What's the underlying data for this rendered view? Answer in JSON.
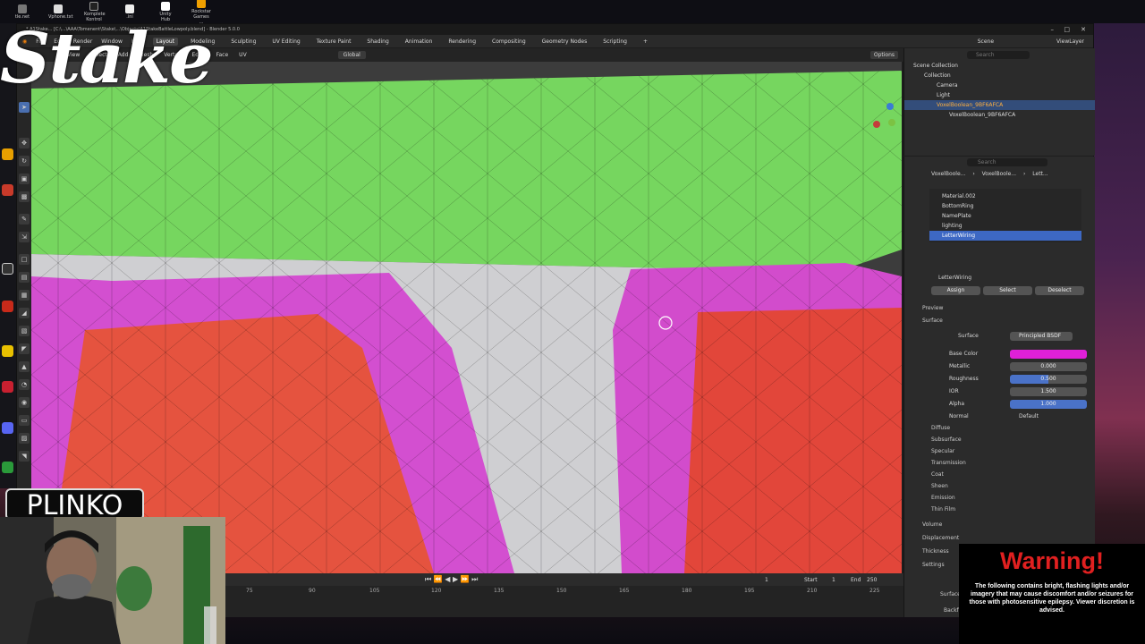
{
  "window_title": "* A1Stake... [C:\\...\\AAA\\Tomenent\\Stake\\...\\Objects\\A1StakeBattleLowpoly.blend] - Blender 5.0.0",
  "taskbar": [
    {
      "label": "tle.net"
    },
    {
      "label": "Vphone.txt"
    },
    {
      "label": "Komplete Kontrol"
    },
    {
      "label": ".ini"
    },
    {
      "label": "Unity Hub"
    },
    {
      "label": "Rockstar Games ..."
    }
  ],
  "menu": [
    "File",
    "Edit",
    "Render",
    "Window",
    "Help"
  ],
  "workspaces": [
    "Layout",
    "Modeling",
    "Sculpting",
    "UV Editing",
    "Texture Paint",
    "Shading",
    "Animation",
    "Rendering",
    "Compositing",
    "Geometry Nodes",
    "Scripting",
    "+"
  ],
  "active_workspace": "Layout",
  "viewport_header": {
    "menus": [
      "View",
      "Select",
      "Add",
      "Mesh",
      "Vertex",
      "Edge",
      "Face",
      "UV"
    ],
    "orientation": "Global",
    "options": "Options"
  },
  "scene": {
    "scene_label": "Scene",
    "viewlayer": "ViewLayer"
  },
  "outliner": {
    "search_placeholder": "Search",
    "items": [
      "Scene Collection",
      "Collection",
      "Camera",
      "Light",
      "VoxelBoolean_9BF6AFCA",
      "VoxelBoolean_9BF6AFCA"
    ]
  },
  "properties": {
    "search_placeholder": "Search",
    "breadcrumb": [
      "VoxelBoole...",
      "VoxelBoole...",
      "Lett..."
    ],
    "material_slots": [
      "Material.002",
      "BottomRing",
      "NamePlate",
      "lighting",
      "LetterWiring"
    ],
    "active_material": "LetterWiring",
    "buttons": [
      "Assign",
      "Select",
      "Deselect"
    ],
    "sections": [
      "Preview",
      "Surface"
    ],
    "surface": {
      "label": "Surface",
      "value": "Principled BSDF"
    },
    "fields": [
      {
        "label": "Base Color",
        "value": ""
      },
      {
        "label": "Metallic",
        "value": "0.000"
      },
      {
        "label": "Roughness",
        "value": "0.500"
      },
      {
        "label": "IOR",
        "value": "1.500"
      },
      {
        "label": "Alpha",
        "value": "1.000"
      },
      {
        "label": "Normal",
        "value": "Default"
      }
    ],
    "subpanels": [
      "Diffuse",
      "Subsurface",
      "Specular",
      "Transmission",
      "Coat",
      "Sheen",
      "Emission",
      "Thin Film"
    ],
    "bottom_panels": [
      "Volume",
      "Displacement",
      "Thickness",
      "Settings",
      "Surface",
      "Backfa"
    ]
  },
  "timeline": {
    "frame": "1",
    "start_label": "Start",
    "start": "1",
    "end_label": "End",
    "end": "250",
    "ticks": [
      "75",
      "90",
      "105",
      "120",
      "135",
      "150",
      "165",
      "180",
      "195",
      "210",
      "225"
    ]
  },
  "overlay": {
    "stake_logo": "Stake",
    "plinko": "PLINKO",
    "warning_title": "Warning!",
    "warning_body": "The following contains bright, flashing lights and/or imagery that may cause discomfort and/or seizures for those with photosensitive epilepsy. Viewer discretion is advised."
  },
  "colors": {
    "base_color": "#e020d8",
    "active_row": "#3d68c4",
    "field_blue": "#4a72c8",
    "mesh_green": "#72d660",
    "mesh_red": "#e54a3c",
    "mesh_magenta": "#d44ad0"
  }
}
